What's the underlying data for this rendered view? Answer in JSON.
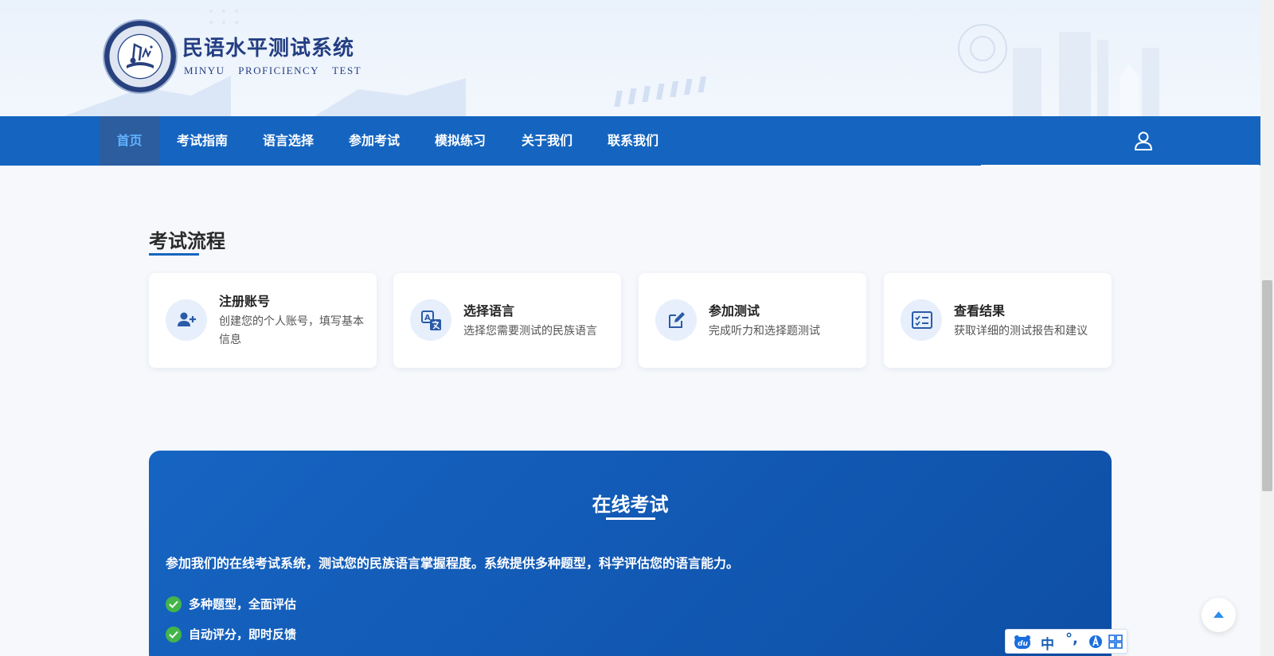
{
  "header": {
    "title": "民语水平测试系统",
    "subtitle": "MINYU PROFICIENCY TEST",
    "logo_icon": "emblem-book-music-logo"
  },
  "nav": {
    "items": [
      {
        "label": "首页",
        "active": true
      },
      {
        "label": "考试指南",
        "active": false
      },
      {
        "label": "语言选择",
        "active": false
      },
      {
        "label": "参加考试",
        "active": false
      },
      {
        "label": "模拟练习",
        "active": false
      },
      {
        "label": "关于我们",
        "active": false
      },
      {
        "label": "联系我们",
        "active": false
      }
    ],
    "user_icon": "user-icon"
  },
  "process": {
    "title": "考试流程",
    "steps": [
      {
        "title": "注册账号",
        "desc": "创建您的个人账号，填写基本信息",
        "icon": "user-plus-icon"
      },
      {
        "title": "选择语言",
        "desc": "选择您需要测试的民族语言",
        "icon": "translate-icon"
      },
      {
        "title": "参加测试",
        "desc": "完成听力和选择题测试",
        "icon": "edit-icon"
      },
      {
        "title": "查看结果",
        "desc": "获取详细的测试报告和建议",
        "icon": "checklist-icon"
      }
    ]
  },
  "online_exam": {
    "title": "在线考试",
    "desc": "参加我们的在线考试系统，测试您的民族语言掌握程度。系统提供多种题型，科学评估您的语言能力。",
    "features": [
      "多种题型，全面评估",
      "自动评分，即时反馈"
    ]
  },
  "ime_toolbar": {
    "lang": "中",
    "punct": "°,"
  },
  "colors": {
    "nav_bg": "#1565c0",
    "active_nav_bg": "#2b5d9f",
    "active_nav_text": "#62b2ff",
    "title_blue": "#233e82",
    "exam_bg": "#1664c2",
    "check_green": "#43b549"
  }
}
